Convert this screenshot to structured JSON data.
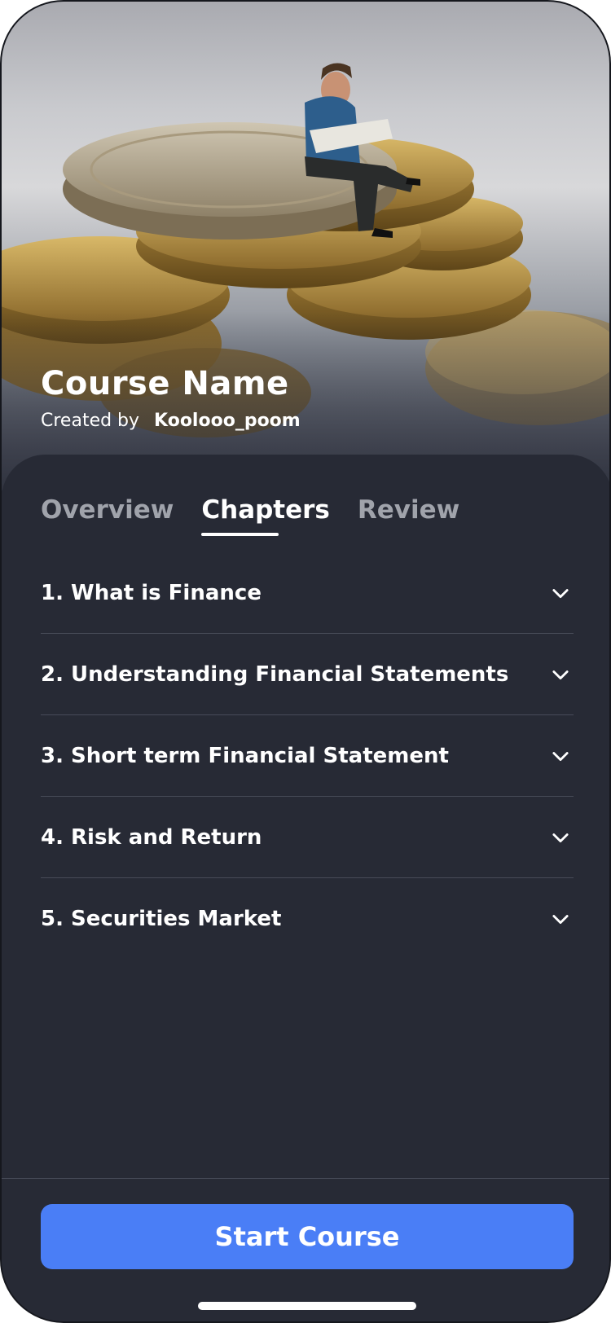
{
  "hero": {
    "image_name": "coins-with-miniature-reader",
    "course_title": "Course Name",
    "created_by_label": "Created by",
    "author": "Koolooo_poom"
  },
  "tabs": [
    {
      "label": "Overview",
      "active": false
    },
    {
      "label": "Chapters",
      "active": true
    },
    {
      "label": "Review",
      "active": false
    }
  ],
  "chapters": [
    {
      "label": "1. What is Finance",
      "icon": "chevron-down-icon"
    },
    {
      "label": "2. Understanding Financial Statements",
      "icon": "chevron-down-icon"
    },
    {
      "label": "3. Short term Financial Statement",
      "icon": "chevron-down-icon"
    },
    {
      "label": "4. Risk and Return",
      "icon": "chevron-down-icon"
    },
    {
      "label": "5. Securities Market",
      "icon": "chevron-down-icon"
    }
  ],
  "footer": {
    "start_label": "Start Course"
  },
  "colors": {
    "background": "#272a35",
    "accent": "#4a7ef6",
    "tab_inactive": "#a0a3ab",
    "divider": "#474b58"
  }
}
